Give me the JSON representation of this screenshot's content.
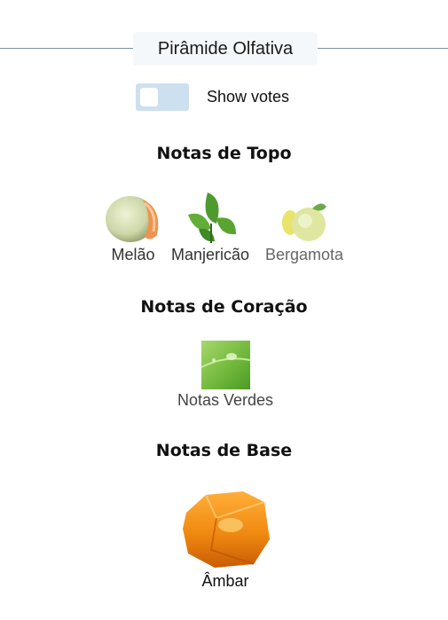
{
  "header": {
    "title": "Pirâmide Olfativa"
  },
  "toggle": {
    "label": "Show votes",
    "checked": false
  },
  "sections": {
    "top": {
      "title": "Notas de Topo",
      "notes": [
        {
          "label": "Melão",
          "icon": "melon-icon"
        },
        {
          "label": "Manjericão",
          "icon": "basil-icon"
        },
        {
          "label": "Bergamota",
          "icon": "bergamot-icon"
        }
      ]
    },
    "heart": {
      "title": "Notas de Coração",
      "notes": [
        {
          "label": "Notas Verdes",
          "icon": "green-notes-icon"
        }
      ]
    },
    "base": {
      "title": "Notas de Base",
      "notes": [
        {
          "label": "Âmbar",
          "icon": "amber-icon"
        }
      ]
    }
  },
  "colors": {
    "line": "#7a92a6",
    "title_bg": "#f5f8fb",
    "toggle_bg": "#cde0ef"
  }
}
